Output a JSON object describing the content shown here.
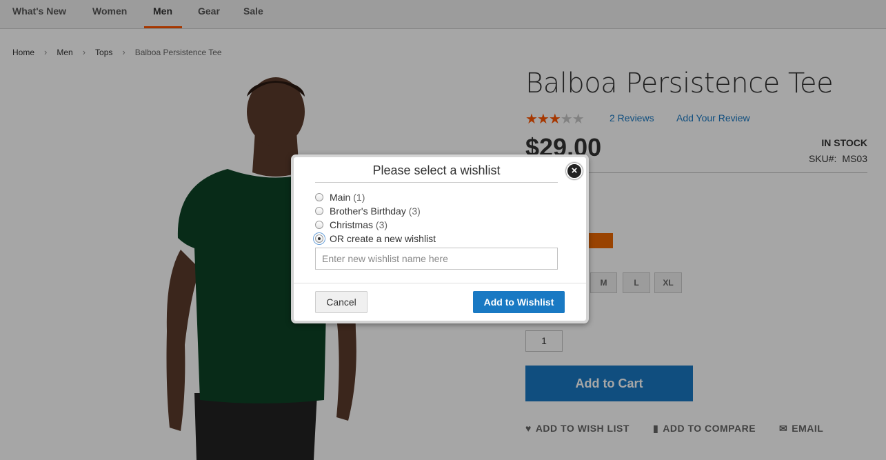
{
  "nav": {
    "items": [
      {
        "label": "What's New"
      },
      {
        "label": "Women"
      },
      {
        "label": "Men"
      },
      {
        "label": "Gear"
      },
      {
        "label": "Sale"
      }
    ]
  },
  "breadcrumbs": [
    "Home",
    "Men",
    "Tops",
    "Balboa Persistence Tee"
  ],
  "product": {
    "title": "Balboa Persistence Tee",
    "rating_stars": 3,
    "rating_max": 5,
    "reviews_link": "2 Reviews",
    "add_review_link": "Add Your Review",
    "price": "$29.00",
    "stock": "IN STOCK",
    "sku_label": "SKU#:",
    "sku_value": "MS03",
    "sizes": [
      "M",
      "L",
      "XL"
    ],
    "qty": "1",
    "add_to_cart": "Add to Cart",
    "actions": {
      "wishlist": "ADD TO WISH LIST",
      "compare": "ADD TO COMPARE",
      "email": "EMAIL"
    },
    "colors": {
      "accent": "#ff5501",
      "swatch": "#eb6703",
      "primary": "#1979c3"
    }
  },
  "modal": {
    "title": "Please select a wishlist",
    "close_icon": "close-icon",
    "options": [
      {
        "label": "Main",
        "count": "(1)",
        "checked": false
      },
      {
        "label": "Brother's Birthday",
        "count": "(3)",
        "checked": false
      },
      {
        "label": "Christmas",
        "count": "(3)",
        "checked": false
      },
      {
        "label": "OR create a new wishlist",
        "count": "",
        "checked": true
      }
    ],
    "new_name_placeholder": "Enter new wishlist name here",
    "cancel": "Cancel",
    "submit": "Add to Wishlist"
  }
}
